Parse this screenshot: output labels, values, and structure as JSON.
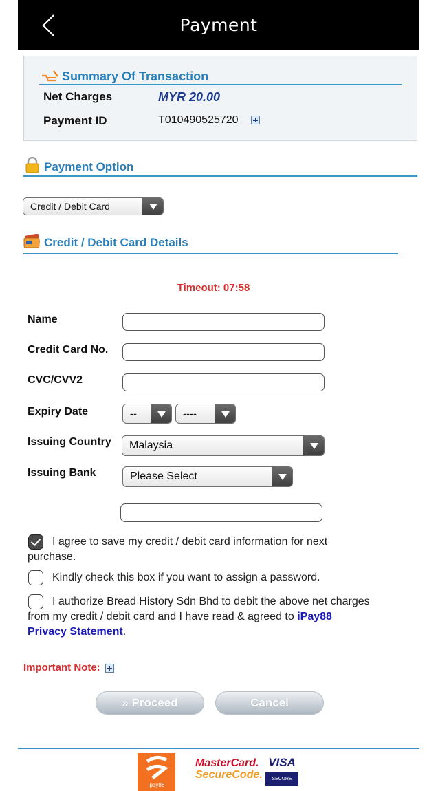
{
  "header": {
    "title": "Payment"
  },
  "summary": {
    "heading": "Summary Of Transaction",
    "net_charges_label": "Net Charges",
    "net_charges_value": "MYR 20.00",
    "payment_id_label": "Payment ID",
    "payment_id_value": "T010490525720"
  },
  "payment_option": {
    "heading": "Payment Option",
    "selected": "Credit / Debit Card"
  },
  "card_details": {
    "heading": "Credit / Debit Card Details"
  },
  "timeout": "Timeout: 07:58",
  "form": {
    "name_label": "Name",
    "card_no_label": "Credit Card No.",
    "cvc_label": "CVC/CVV2",
    "expiry_label": "Expiry Date",
    "expiry_month": "--",
    "expiry_year": "----",
    "country_label": "Issuing Country",
    "country_value": "Malaysia",
    "bank_label": "Issuing Bank",
    "bank_value": "Please Select"
  },
  "agreements": {
    "save_card": "I agree to save my credit / debit card information for next purchase.",
    "save_card_checked": true,
    "password": "Kindly check this box if you want to assign a password.",
    "password_checked": false,
    "authorize": "I authorize Bread History Sdn Bhd to debit the above net charges from my credit / debit card and I have read & agreed to",
    "authorize_checked": false,
    "privacy_link": "iPay88 Privacy Statement",
    "privacy_suffix": "."
  },
  "important_note": "Important Note:",
  "buttons": {
    "proceed": "» Proceed",
    "cancel": "Cancel"
  },
  "footer": {
    "ipay_text": "ipay88",
    "mastercard_line1": "MasterCard.",
    "mastercard_line2": "SecureCode.",
    "visa_line1": "VISA",
    "visa_line2": "SECURE"
  },
  "colors": {
    "accent": "#2a7fb8",
    "alert": "#d32f2f",
    "link": "#1b1bb5",
    "brand_ipay": "#f37021"
  }
}
